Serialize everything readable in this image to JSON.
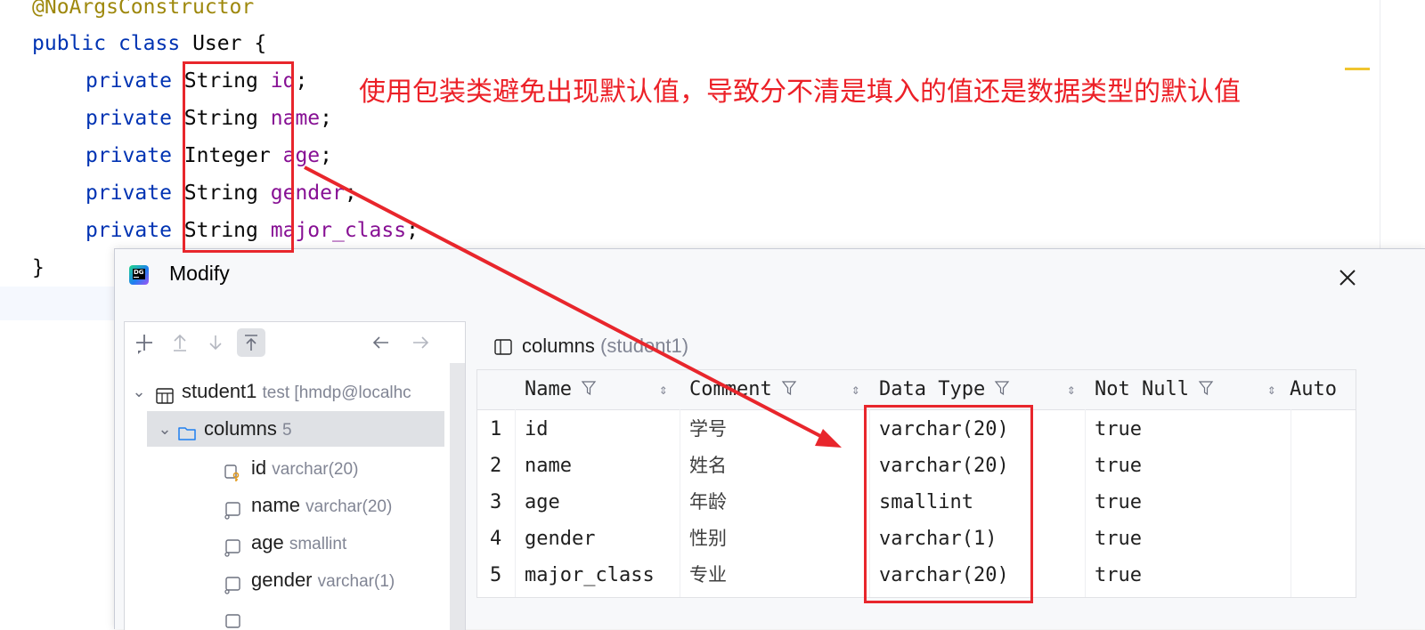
{
  "editor": {
    "lines": [
      {
        "annotation": "@NoArgsConstructor"
      },
      {
        "kw1": "public",
        "kw2": "class",
        "cls": "User",
        "brace": "{"
      },
      {
        "kw": "private",
        "type": "String",
        "field": "id",
        "end": ";"
      },
      {
        "kw": "private",
        "type": "String",
        "field": "name",
        "end": ";"
      },
      {
        "kw": "private",
        "type": "Integer",
        "field": "age",
        "end": ";"
      },
      {
        "kw": "private",
        "type": "String",
        "field": "gender",
        "end": ";"
      },
      {
        "kw": "private",
        "type": "String",
        "field": "major_class",
        "end": ";"
      },
      {
        "brace": "}"
      }
    ]
  },
  "annotation": {
    "note": "使用包装类避免出现默认值，导致分不清是填入的值还是数据类型的默认值",
    "color": "#e8262c"
  },
  "dialog": {
    "title": "Modify",
    "close_label": "×",
    "toolbar_icons": [
      "add-icon",
      "move-up-icon",
      "move-down-icon",
      "pin-top-icon",
      "back-icon",
      "forward-icon"
    ],
    "tree": {
      "root": {
        "name": "student1",
        "detail": "test [hmdp@localhc"
      },
      "folder": {
        "name": "columns",
        "count": "5"
      },
      "items": [
        {
          "name": "id",
          "type": "varchar(20)",
          "icon": "primary-key-column-icon"
        },
        {
          "name": "name",
          "type": "varchar(20)",
          "icon": "column-icon"
        },
        {
          "name": "age",
          "type": "smallint",
          "icon": "column-icon"
        },
        {
          "name": "gender",
          "type": "varchar(1)",
          "icon": "column-icon"
        }
      ]
    },
    "grid_title": {
      "name": "columns",
      "sub": "(student1)"
    },
    "grid": {
      "headers": [
        "Name",
        "Comment",
        "Data Type",
        "Not Null",
        "Auto"
      ],
      "rows": [
        {
          "n": "1",
          "name": "id",
          "comment": "学号",
          "type": "varchar(20)",
          "not_null": "true"
        },
        {
          "n": "2",
          "name": "name",
          "comment": "姓名",
          "type": "varchar(20)",
          "not_null": "true"
        },
        {
          "n": "3",
          "name": "age",
          "comment": "年龄",
          "type": "smallint",
          "not_null": "true"
        },
        {
          "n": "4",
          "name": "gender",
          "comment": "性别",
          "type": "varchar(1)",
          "not_null": "true"
        },
        {
          "n": "5",
          "name": "major_class",
          "comment": "专业",
          "type": "varchar(20)",
          "not_null": "true"
        }
      ]
    }
  }
}
